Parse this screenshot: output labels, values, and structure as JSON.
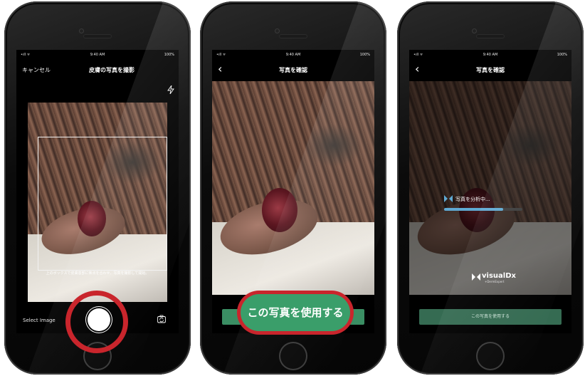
{
  "status": {
    "time": "9:40 AM",
    "battery": "100%",
    "signal": "•ıll ᯤ"
  },
  "screen1": {
    "cancel_label": "キャンセル",
    "title": "皮膚の写真を撮影",
    "hint": "上のボックスで皮膚患部に焦点を合わせ、写真を撮影して開始。",
    "select_image_label": "Select Image"
  },
  "screen2": {
    "title": "写真を確認",
    "use_photo_label": "この写真を使用する"
  },
  "screen3": {
    "title": "写真を確認",
    "analyzing_text": "写真を分析中...",
    "progress": 0.75,
    "logo_name": "visualDx",
    "logo_sub": "+DermExpert",
    "use_photo_label": "この写真を使用する"
  },
  "colors": {
    "accent_green": "#3a9e6a",
    "highlight_red": "#c9252c",
    "progress_blue": "#5fa9d2"
  },
  "icons": [
    "back-chevron-icon",
    "flash-icon",
    "camera-flip-icon",
    "shutter-icon",
    "visualdx-logo-icon"
  ]
}
